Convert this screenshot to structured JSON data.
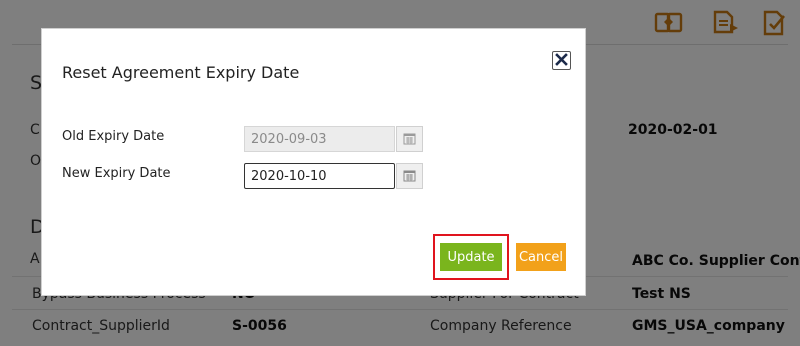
{
  "toolbar": {
    "icons": [
      "copy-agreement-icon",
      "add-document-icon",
      "edit-document-icon"
    ],
    "accent_color": "#c97a14"
  },
  "background": {
    "section_heading_1_fragment": "S",
    "section_heading_2_fragment": "D",
    "left_fragments": [
      "C",
      "O",
      "A"
    ],
    "right_date_value": "2020-02-01",
    "rows": [
      {
        "label": "Bypass Business Process",
        "value": "NO",
        "label2": "Supplier For Contract",
        "value2": "Test NS"
      },
      {
        "label": "Contract_SupplierId",
        "value": "S-0056",
        "label2": "Company Reference",
        "value2": "GMS_USA_company"
      }
    ],
    "right_value_a": "ABC Co. Supplier Contract"
  },
  "modal": {
    "title": "Reset Agreement Expiry Date",
    "close_icon": "close-icon",
    "old_expiry_label": "Old Expiry Date",
    "old_expiry_value": "2020-09-03",
    "new_expiry_label": "New Expiry Date",
    "new_expiry_value": "2020-10-10",
    "calendar_icon": "calendar-icon",
    "update_label": "Update",
    "cancel_label": "Cancel",
    "update_color": "#7ab51d",
    "cancel_color": "#f2a11a",
    "highlight_color": "#e0141e"
  }
}
